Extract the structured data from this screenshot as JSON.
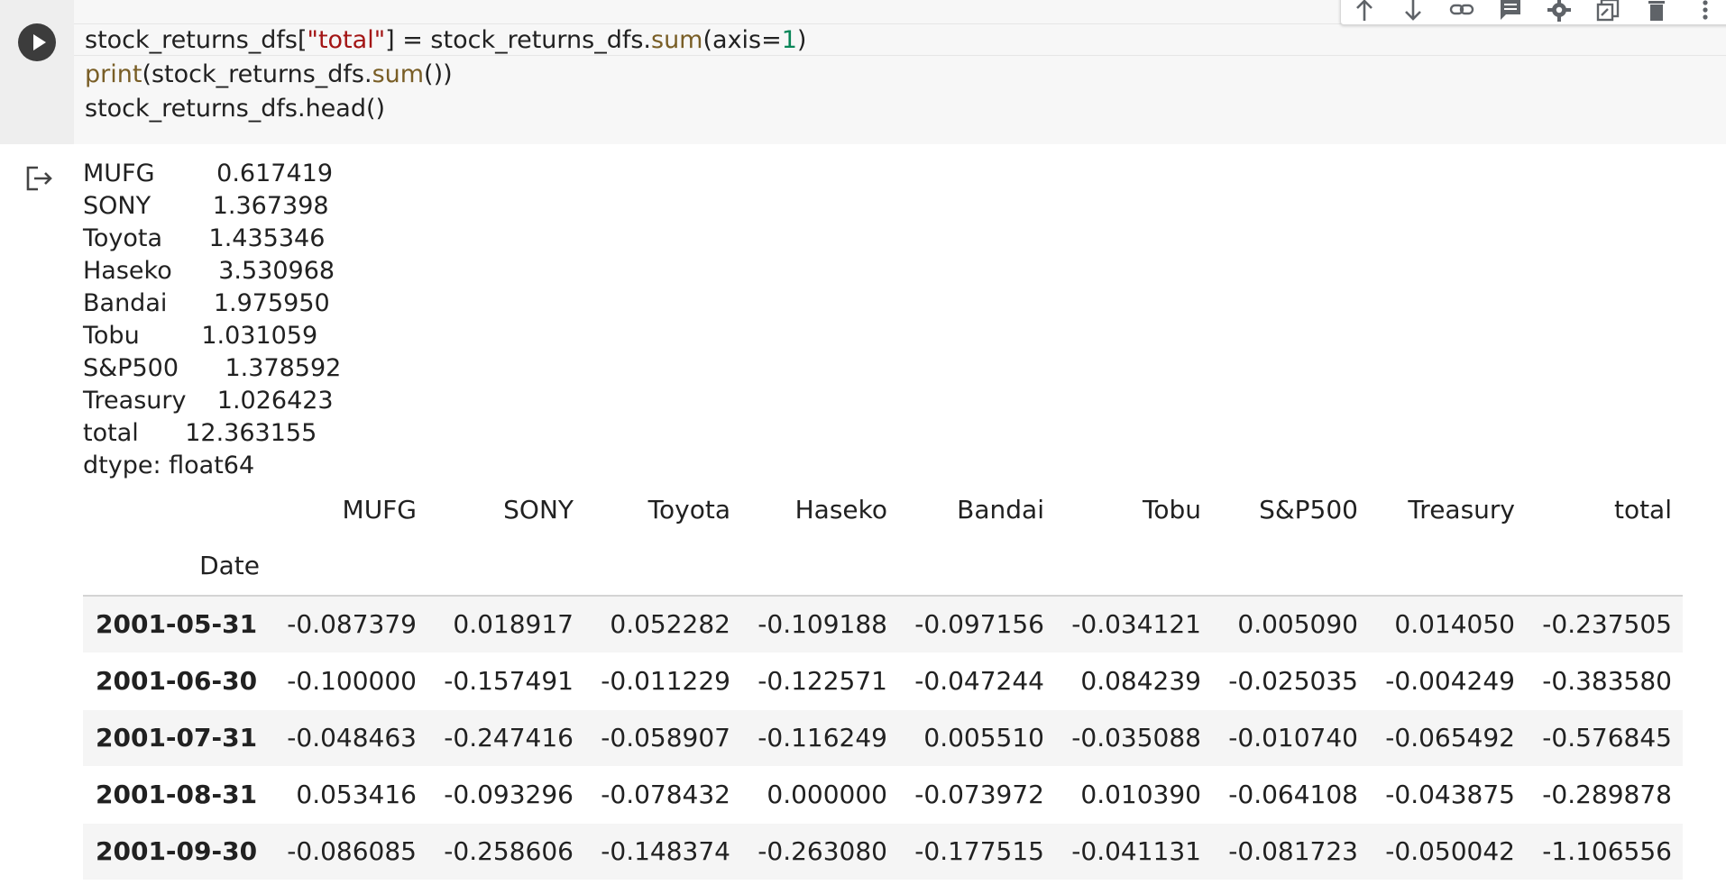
{
  "code_cell": {
    "lines": [
      [
        {
          "text": "stock_returns_dfs[",
          "kind": "plain"
        },
        {
          "text": "\"total\"",
          "kind": "str"
        },
        {
          "text": "] = stock_returns_dfs.",
          "kind": "plain"
        },
        {
          "text": "sum",
          "kind": "fn"
        },
        {
          "text": "(axis=",
          "kind": "plain"
        },
        {
          "text": "1",
          "kind": "num"
        },
        {
          "text": ")",
          "kind": "plain"
        }
      ],
      [
        {
          "text": "print",
          "kind": "fn"
        },
        {
          "text": "(stock_returns_dfs.",
          "kind": "plain"
        },
        {
          "text": "sum",
          "kind": "fn"
        },
        {
          "text": "())",
          "kind": "plain"
        }
      ],
      [
        {
          "text": "stock_returns_dfs.head()",
          "kind": "plain"
        }
      ]
    ]
  },
  "icons": {
    "run": "play-icon",
    "output": "output-redirect-icon",
    "toolbar": [
      "arrow-up-icon",
      "arrow-down-icon",
      "link-icon",
      "comment-icon",
      "gear-icon",
      "mirror-cell-icon",
      "delete-icon",
      "more-vert-icon"
    ]
  },
  "colors": {
    "string": "#a31515",
    "function": "#795e26",
    "number": "#098658",
    "run_button": "#3c3c3c",
    "cell_background": "#f7f7f7",
    "striped_row": "#f5f5f5"
  },
  "stdout": [
    "MUFG        0.617419",
    "SONY        1.367398",
    "Toyota      1.435346",
    "Haseko      3.530968",
    "Bandai      1.975950",
    "Tobu        1.031059",
    "S&P500      1.378592",
    "Treasury    1.026423",
    "total      12.363155",
    "dtype: float64"
  ],
  "dataframe": {
    "columns": [
      "MUFG",
      "SONY",
      "Toyota",
      "Haseko",
      "Bandai",
      "Tobu",
      "S&P500",
      "Treasury",
      "total"
    ],
    "index_name": "Date",
    "rows": [
      {
        "index": "2001-05-31",
        "values": [
          "-0.087379",
          "0.018917",
          "0.052282",
          "-0.109188",
          "-0.097156",
          "-0.034121",
          "0.005090",
          "0.014050",
          "-0.237505"
        ]
      },
      {
        "index": "2001-06-30",
        "values": [
          "-0.100000",
          "-0.157491",
          "-0.011229",
          "-0.122571",
          "-0.047244",
          "0.084239",
          "-0.025035",
          "-0.004249",
          "-0.383580"
        ]
      },
      {
        "index": "2001-07-31",
        "values": [
          "-0.048463",
          "-0.247416",
          "-0.058907",
          "-0.116249",
          "0.005510",
          "-0.035088",
          "-0.010740",
          "-0.065492",
          "-0.576845"
        ]
      },
      {
        "index": "2001-08-31",
        "values": [
          "0.053416",
          "-0.093296",
          "-0.078432",
          "0.000000",
          "-0.073972",
          "0.010390",
          "-0.064108",
          "-0.043875",
          "-0.289878"
        ]
      },
      {
        "index": "2001-09-30",
        "values": [
          "-0.086085",
          "-0.258606",
          "-0.148374",
          "-0.263080",
          "-0.177515",
          "-0.041131",
          "-0.081723",
          "-0.050042",
          "-1.106556"
        ]
      }
    ]
  }
}
